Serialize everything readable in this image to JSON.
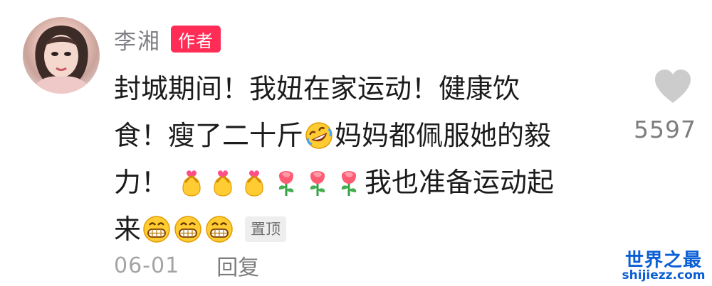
{
  "comment": {
    "author": {
      "name": "李湘",
      "badge": "作者"
    },
    "lines": [
      {
        "segments": [
          "封城期间！我妞在家运动！健康饮"
        ]
      },
      {
        "segments": [
          "食！瘦了二十斤",
          "妈妈都佩服她的毅"
        ],
        "emoji": "rofl-emoji"
      },
      {
        "segments": [
          "力！",
          "我也准备运动起"
        ],
        "emojis": [
          "hand-heart-emoji",
          "hand-heart-emoji",
          "hand-heart-emoji",
          "rose-emoji",
          "rose-emoji",
          "rose-emoji"
        ]
      },
      {
        "segments": [
          "来"
        ],
        "emojis": [
          "grin-emoji",
          "grin-emoji",
          "grin-emoji"
        ]
      }
    ],
    "pin_label": "置顶",
    "date": "06-01",
    "reply_label": "回复",
    "likes": "5597",
    "like_icon": "heart-icon"
  },
  "watermark": {
    "title": "世界之最",
    "url": "shijiezz.com",
    "color": "#0b5fd4"
  },
  "colors": {
    "author_badge": "#ff2c55",
    "pin_badge_bg": "#eeeeee",
    "secondary_text": "#7f8085"
  }
}
